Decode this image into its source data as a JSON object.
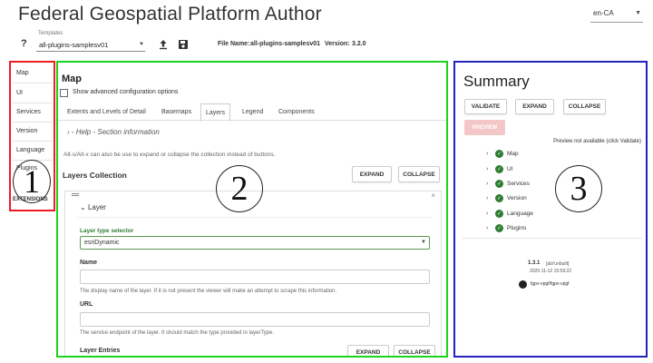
{
  "app": {
    "title": "Federal Geospatial Platform Author",
    "language": "en-CA"
  },
  "toolbar": {
    "templates_label": "Templates",
    "help": "?",
    "template_value": "all-plugins-samplesv01",
    "file_name_label": "File Name:",
    "file_name_value": "all-plugins-samplesv01",
    "version_label": "Version:",
    "version_value": "3.2.0"
  },
  "nav": {
    "items": [
      "Map",
      "UI",
      "Services",
      "Version",
      "Language",
      "Plugins"
    ],
    "extensions": "EXTENSIONS"
  },
  "annotations": [
    "1",
    "2",
    "3"
  ],
  "main": {
    "title": "Map",
    "advanced_label": "Show advanced configuration options",
    "tabs": [
      "Extents and Levels of Detail",
      "Basemaps",
      "Layers",
      "Legend",
      "Components"
    ],
    "active_tab": "Layers",
    "help_section": "- Help - Section information",
    "hint": "Alt-s/Alt-x can also be use to expand or collapse the collection instead of buttons.",
    "collection_title": "Layers Collection",
    "expand_label": "EXPAND",
    "collapse_label": "COLLAPSE",
    "layer": {
      "title": "Layer",
      "type_label": "Layer type selector",
      "type_value": "esriDynamic",
      "name_label": "Name",
      "name_value": "",
      "name_desc": "The display name of the layer. If it is not present the viewer will make an attempt to scrape this information.",
      "url_label": "URL",
      "url_value": "",
      "url_desc": "The service endpoint of the layer. It should match the type provided in layerType.",
      "cut_label": "Layer Entries"
    }
  },
  "summary": {
    "title": "Summary",
    "validate_label": "VALIDATE",
    "expand_label": "EXPAND",
    "collapse_label": "COLLAPSE",
    "preview_label": "PREVIEW",
    "preview_note": "Preview not available (click Validate)",
    "tree": [
      "Map",
      "UI",
      "Services",
      "Version",
      "Language",
      "Plugins"
    ],
    "version": "1.3.1",
    "version_tag": "[ab/'unbuilt]",
    "build_date": "2020-11-12 15:59:22",
    "repo_link": "fgpv-vpgf/fgpv-vpgf"
  },
  "colors": {
    "nav_border": "#ee1c24",
    "main_border": "#1dd41d",
    "summary_border": "#2222bb",
    "valid": "#2e7d32"
  }
}
